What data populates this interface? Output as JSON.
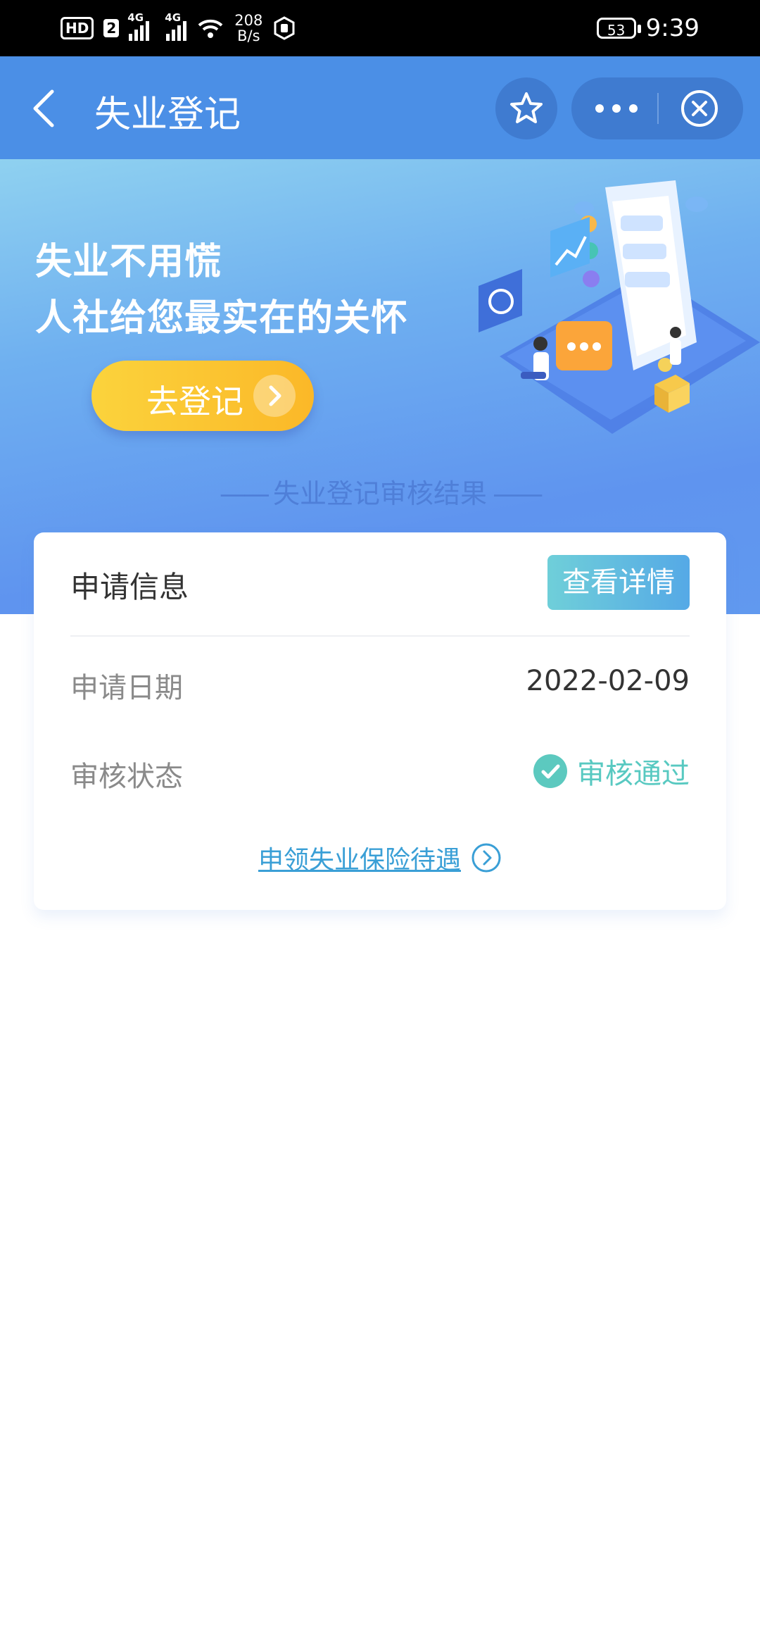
{
  "status_bar": {
    "hd": "HD",
    "sim": "2",
    "net1": "4G",
    "net2": "4G",
    "speed_value": "208",
    "speed_unit": "B/s",
    "battery": "53",
    "time": "9:39"
  },
  "header": {
    "title": "失业登记"
  },
  "banner": {
    "slogan_line1": "失业不用慌",
    "slogan_line2": "人社给您最实在的关怀",
    "go_button": "去登记",
    "section_title": "失业登记审核结果"
  },
  "card": {
    "title": "申请信息",
    "detail_button": "查看详情",
    "date_label": "申请日期",
    "date_value": "2022-02-09",
    "status_label": "审核状态",
    "status_value": "审核通过",
    "claim_link": "申领失业保险待遇"
  },
  "colors": {
    "header_bg": "#4b8fe6",
    "status_green": "#58c9c1",
    "link_blue": "#3a9fd6",
    "button_yellow": "#fbc531"
  }
}
